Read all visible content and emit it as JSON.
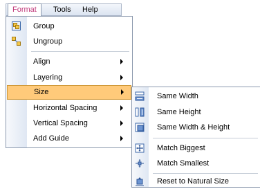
{
  "menubar": {
    "items": [
      {
        "label": "Format",
        "active": true
      },
      {
        "label": "Tools"
      },
      {
        "label": "Help"
      }
    ]
  },
  "format_menu": {
    "items": [
      {
        "label": "Group",
        "icon": "group-icon"
      },
      {
        "label": "Ungroup",
        "icon": "ungroup-icon"
      },
      {
        "label": "Align",
        "submenu": true
      },
      {
        "label": "Layering",
        "submenu": true
      },
      {
        "label": "Size",
        "submenu": true,
        "highlighted": true
      },
      {
        "label": "Horizontal Spacing",
        "submenu": true
      },
      {
        "label": "Vertical Spacing",
        "submenu": true
      },
      {
        "label": "Add Guide",
        "submenu": true
      }
    ]
  },
  "size_submenu": {
    "items": [
      {
        "label": "Same Width",
        "icon": "same-width-icon"
      },
      {
        "label": "Same Height",
        "icon": "same-height-icon"
      },
      {
        "label": "Same Width & Height",
        "icon": "same-width-height-icon"
      },
      {
        "label": "Match Biggest",
        "icon": "match-biggest-icon"
      },
      {
        "label": "Match Smallest",
        "icon": "match-smallest-icon"
      },
      {
        "label": "Reset to Natural Size",
        "icon": "reset-natural-size-icon"
      }
    ]
  },
  "colors": {
    "highlight": "#ffca7a",
    "highlight_border": "#d19a3b",
    "active_menu_text": "#c0387a",
    "menu_border": "#8a98ad"
  }
}
